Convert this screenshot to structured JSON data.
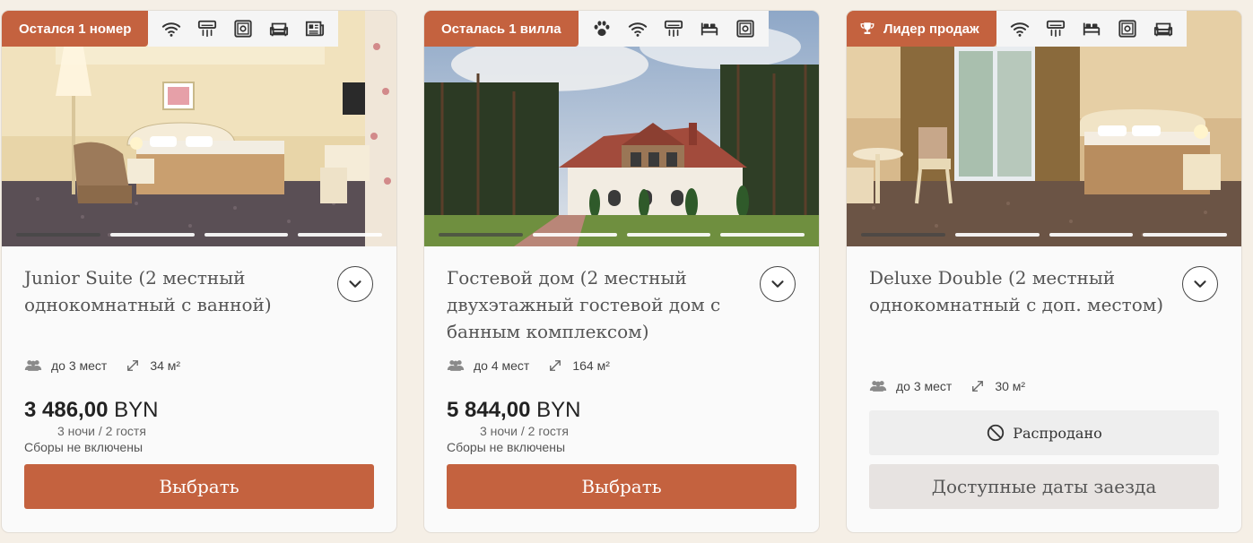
{
  "cards": [
    {
      "badge": "Остался 1 номер",
      "amenities": [
        "wifi-icon",
        "air-conditioner-icon",
        "safe-icon",
        "sofa-icon",
        "newspaper-icon"
      ],
      "title": "Junior Suite (2 местный однокомнатный с ванной)",
      "guests": "до 3 мест",
      "area": "34 м²",
      "price_value": "3 486,00",
      "currency": "BYN",
      "nights": "3 ночи / 2 гостя",
      "fees": "Сборы не включены",
      "button": "Выбрать",
      "slide_dots": 4,
      "active_dot": 1
    },
    {
      "badge": "Осталась 1 вилла",
      "amenities": [
        "paw-icon",
        "wifi-icon",
        "air-conditioner-icon",
        "bed-icon",
        "safe-icon"
      ],
      "title": "Гостевой дом (2 местный двухэтажный гостевой дом с банным комплексом)",
      "guests": "до 4 мест",
      "area": "164 м²",
      "price_value": "5 844,00",
      "currency": "BYN",
      "nights": "3 ночи / 2 гостя",
      "fees": "Сборы не включены",
      "button": "Выбрать",
      "slide_dots": 4,
      "active_dot": 1
    },
    {
      "badge": "Лидер продаж",
      "badge_icon": "trophy-icon",
      "amenities": [
        "wifi-icon",
        "air-conditioner-icon",
        "bed-icon",
        "safe-icon",
        "sofa-icon"
      ],
      "title": "Deluxe Double (2 местный однокомнатный с доп. местом)",
      "guests": "до 3 мест",
      "area": "30 м²",
      "sold_out": "Распродано",
      "button": "Доступные даты заезда",
      "slide_dots": 4,
      "active_dot": 1
    }
  ],
  "colors": {
    "accent": "#c4623f",
    "page_bg": "#f5efe6",
    "card_bg": "#fafafa",
    "disabled_btn": "#e7e3e1"
  }
}
